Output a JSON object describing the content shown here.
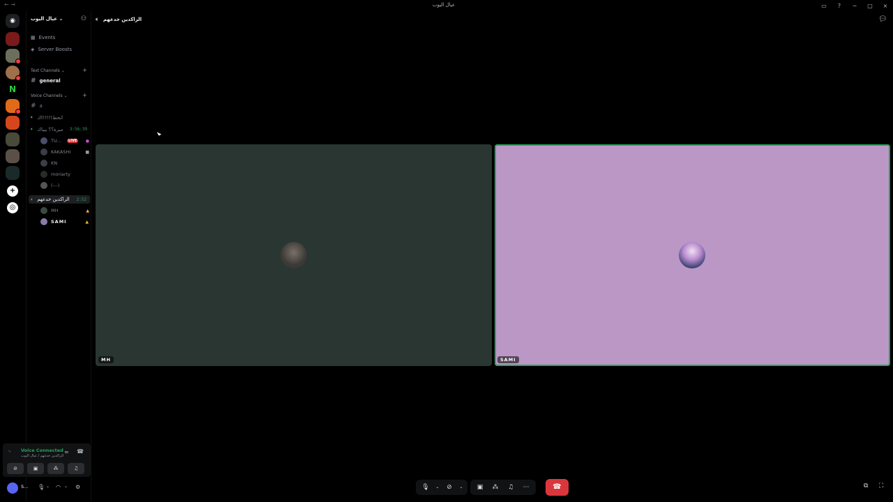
{
  "titlebar": {
    "nav_back": "←",
    "nav_forward": "→",
    "title": "عيال اليوب",
    "inbox_icon": "inbox-icon",
    "help_icon": "help-icon",
    "minimize": "−",
    "maximize": "□",
    "close": "×"
  },
  "sidebar": {
    "server_name": "عيال اليوب",
    "events_label": "Events",
    "boosts_label": "Server Boosts",
    "text_category": "Text Channels",
    "voice_category": "Voice Channels",
    "channels": {
      "general": "general",
      "a": "a",
      "voice1": "انحط!!!!!اك",
      "voice2": "مبرة؟؟ بيباك",
      "voice2_timer": "3:56:39",
      "voice3": "الراكدين خدعهم",
      "voice3_timer": "2:52"
    },
    "voice2_users": [
      "TU...",
      "KAKASHI",
      "KN",
      "moriarty",
      "(---)"
    ],
    "voice3_users": [
      "MH",
      "SAMI"
    ],
    "live_badge": "LIVE"
  },
  "voice_panel": {
    "status": "Voice Connected",
    "subtitle": "الراكدين خدعهم / عيال اليوب",
    "user_short": "S..."
  },
  "header": {
    "channel_name": "الراكدين خدعهم"
  },
  "tiles": [
    {
      "name": "MH",
      "bg": "#2a3632",
      "speaking": false
    },
    {
      "name": "SAMI",
      "bg": "#bb97c6",
      "speaking": true
    }
  ],
  "colors": {
    "accent_green": "#23a55a",
    "danger_red": "#da373c",
    "live_red": "#da373c"
  }
}
